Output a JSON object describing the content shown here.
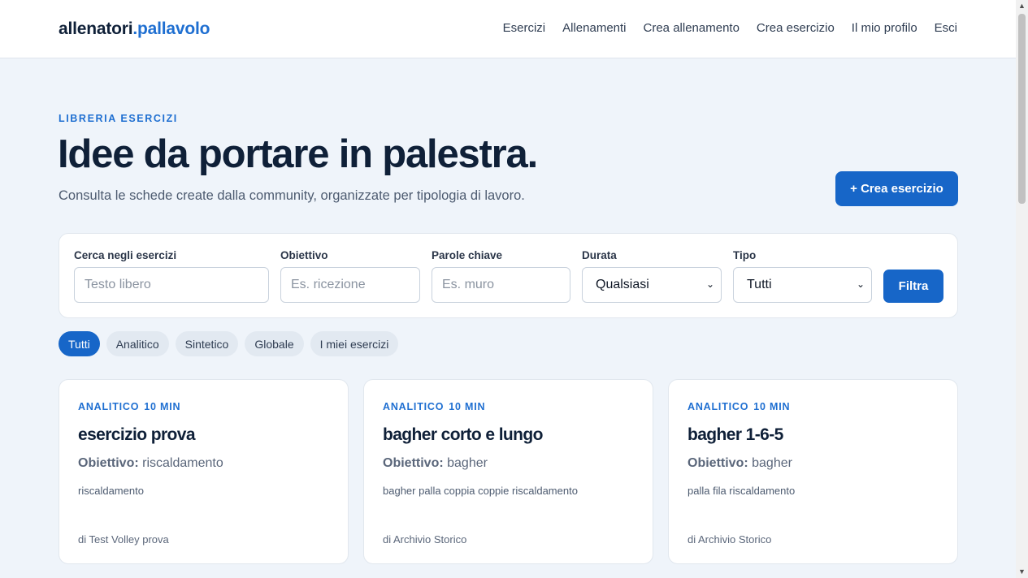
{
  "header": {
    "logo_part1": "allenatori",
    "logo_part2": ".pallavolo",
    "nav": [
      "Esercizi",
      "Allenamenti",
      "Crea allenamento",
      "Crea esercizio",
      "Il mio profilo",
      "Esci"
    ]
  },
  "hero": {
    "eyebrow": "LIBRERIA ESERCIZI",
    "title": "Idee da portare in palestra.",
    "subtitle": "Consulta le schede create dalla community, organizzate per tipologia di lavoro.",
    "create_button": "+ Crea esercizio"
  },
  "filters": {
    "search": {
      "label": "Cerca negli esercizi",
      "placeholder": "Testo libero",
      "value": ""
    },
    "goal": {
      "label": "Obiettivo",
      "placeholder": "Es. ricezione",
      "value": ""
    },
    "keywords": {
      "label": "Parole chiave",
      "placeholder": "Es. muro",
      "value": ""
    },
    "duration": {
      "label": "Durata",
      "selected": "Qualsiasi"
    },
    "type": {
      "label": "Tipo",
      "selected": "Tutti"
    },
    "submit": "Filtra"
  },
  "chips": [
    {
      "label": "Tutti",
      "active": true
    },
    {
      "label": "Analitico",
      "active": false
    },
    {
      "label": "Sintetico",
      "active": false
    },
    {
      "label": "Globale",
      "active": false
    },
    {
      "label": "I miei esercizi",
      "active": false
    }
  ],
  "cards": [
    {
      "type": "ANALITICO",
      "duration": "10 MIN",
      "title": "esercizio prova",
      "goal_label": "Obiettivo:",
      "goal": "riscaldamento",
      "tags": "riscaldamento",
      "author": "di Test Volley prova"
    },
    {
      "type": "ANALITICO",
      "duration": "10 MIN",
      "title": "bagher corto e lungo",
      "goal_label": "Obiettivo:",
      "goal": "bagher",
      "tags": "bagher palla coppia coppie riscaldamento",
      "author": "di Archivio Storico"
    },
    {
      "type": "ANALITICO",
      "duration": "10 MIN",
      "title": "bagher 1-6-5",
      "goal_label": "Obiettivo:",
      "goal": "bagher",
      "tags": "palla fila riscaldamento",
      "author": "di Archivio Storico"
    }
  ],
  "colors": {
    "accent": "#1766c8",
    "text": "#0f2038",
    "background": "#eff4fa"
  }
}
